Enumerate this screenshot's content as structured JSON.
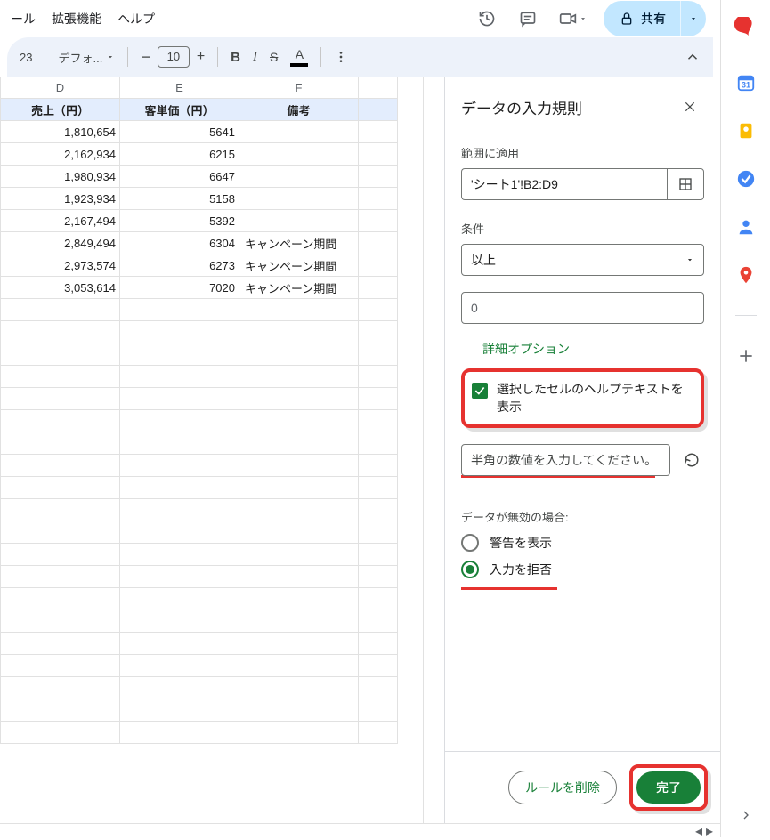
{
  "menubar": {
    "item1": "ール",
    "item2": "拡張機能",
    "item3": "ヘルプ"
  },
  "topicons": {
    "share_label": "共有"
  },
  "toolbar": {
    "num_format": "23",
    "font_label": "デフォ...",
    "font_size": "10"
  },
  "sheet": {
    "cols": {
      "d": "D",
      "e": "E",
      "f": "F"
    },
    "headers": {
      "d": "売上（円）",
      "e": "客単価（円）",
      "f": "備考"
    },
    "rows": [
      {
        "d": "1,810,654",
        "e": "5641",
        "f": ""
      },
      {
        "d": "2,162,934",
        "e": "6215",
        "f": ""
      },
      {
        "d": "1,980,934",
        "e": "6647",
        "f": ""
      },
      {
        "d": "1,923,934",
        "e": "5158",
        "f": ""
      },
      {
        "d": "2,167,494",
        "e": "5392",
        "f": ""
      },
      {
        "d": "2,849,494",
        "e": "6304",
        "f": "キャンペーン期間"
      },
      {
        "d": "2,973,574",
        "e": "6273",
        "f": "キャンペーン期間"
      },
      {
        "d": "3,053,614",
        "e": "7020",
        "f": "キャンペーン期間"
      }
    ]
  },
  "panel": {
    "title": "データの入力規則",
    "range_label": "範囲に適用",
    "range_value": "'シート1'!B2:D9",
    "condition_label": "条件",
    "condition_value": "以上",
    "threshold_value": "0",
    "advanced_link": "詳細オプション",
    "checkbox_label": "選択したセルのヘルプテキストを表示",
    "help_text": "半角の数値を入力してください。",
    "invalid_label": "データが無効の場合:",
    "radio_warn": "警告を表示",
    "radio_reject": "入力を拒否",
    "btn_delete": "ルールを削除",
    "btn_done": "完了"
  }
}
